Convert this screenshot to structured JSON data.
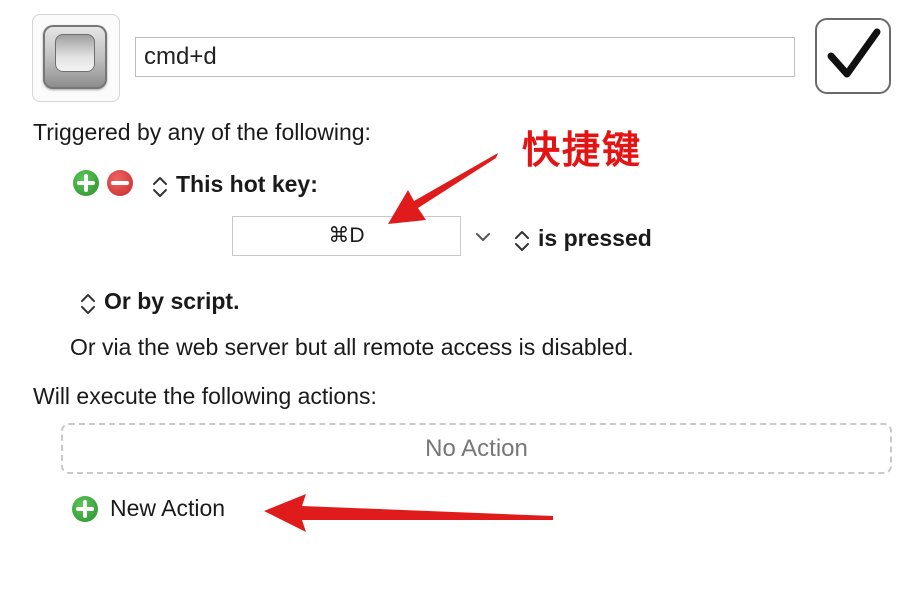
{
  "macro": {
    "name": "cmd+d",
    "icon": "keycap-icon",
    "enabled": true
  },
  "triggers": {
    "heading": "Triggered by any of the following:",
    "hotkey_label": "This hot key:",
    "hotkey_value": "⌘D",
    "pressed_label": "is pressed",
    "script_label": "Or by script.",
    "web_server_text": "Or via the web server but all remote access is disabled."
  },
  "actions": {
    "heading": "Will execute the following actions:",
    "placeholder": "No Action",
    "new_action_label": "New Action"
  },
  "annotation": {
    "label": "快捷键",
    "color": "#e41414"
  }
}
